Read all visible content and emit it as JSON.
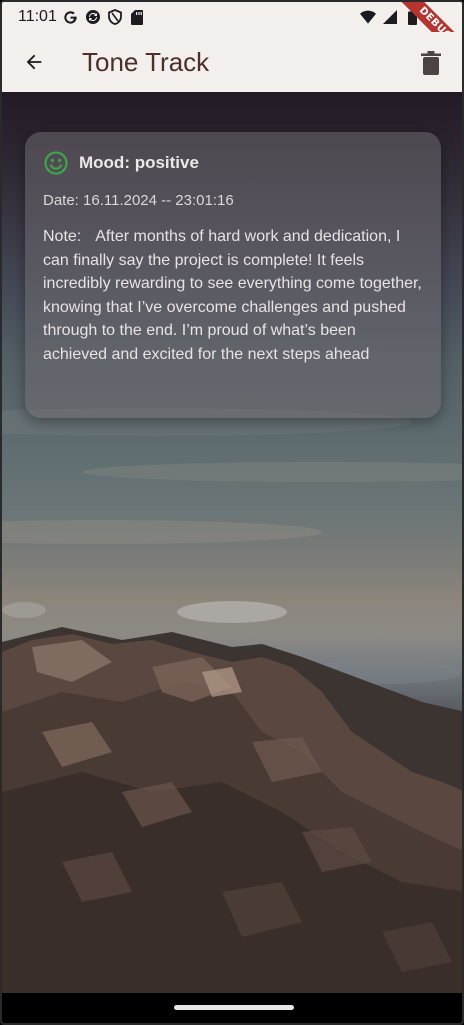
{
  "status_bar": {
    "time": "11:01",
    "left_icons": [
      "google-icon",
      "sync-icon",
      "shield-icon",
      "sd-card-icon"
    ],
    "right_icons": [
      "wifi-icon",
      "cell-signal-icon",
      "battery-icon"
    ],
    "debug_banner": "DEBUG"
  },
  "app_bar": {
    "title": "Tone Track",
    "back_icon": "arrow-back-icon",
    "delete_icon": "trash-icon"
  },
  "entry": {
    "mood_icon": "smiley-icon",
    "mood_color": "#3fa34d",
    "mood_label": "Mood: positive",
    "date_line": "Date: 16.11.2024 -- 23:01:16",
    "note_label": "Note:",
    "note_text": "After months of hard work and dedication, I can finally say the project is complete! It feels incredibly rewarding to see everything come together, knowing that I’ve overcome challenges and pushed through to the end. I’m proud of what’s been achieved and excited for the next steps ahead"
  },
  "colors": {
    "app_bar_bg": "#f3efed",
    "title_color": "#4a2f2a"
  }
}
